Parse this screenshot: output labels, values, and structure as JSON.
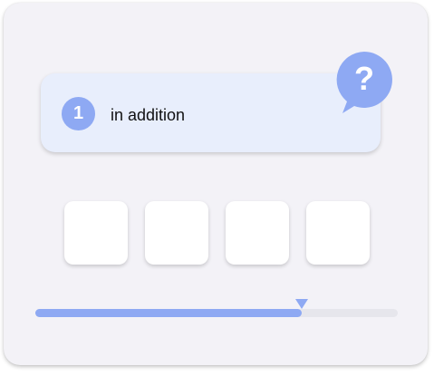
{
  "question": {
    "number": "1",
    "text": "in addition"
  },
  "help": {
    "icon": "question-bubble-icon",
    "glyph": "?"
  },
  "answer_slots": [
    "",
    "",
    "",
    ""
  ],
  "progress": {
    "fraction": 0.735
  },
  "colors": {
    "accent": "#8ea9f3",
    "card_background": "#e8eefc",
    "panel_background": "#f3f2f7",
    "track": "#e6e6ec"
  }
}
